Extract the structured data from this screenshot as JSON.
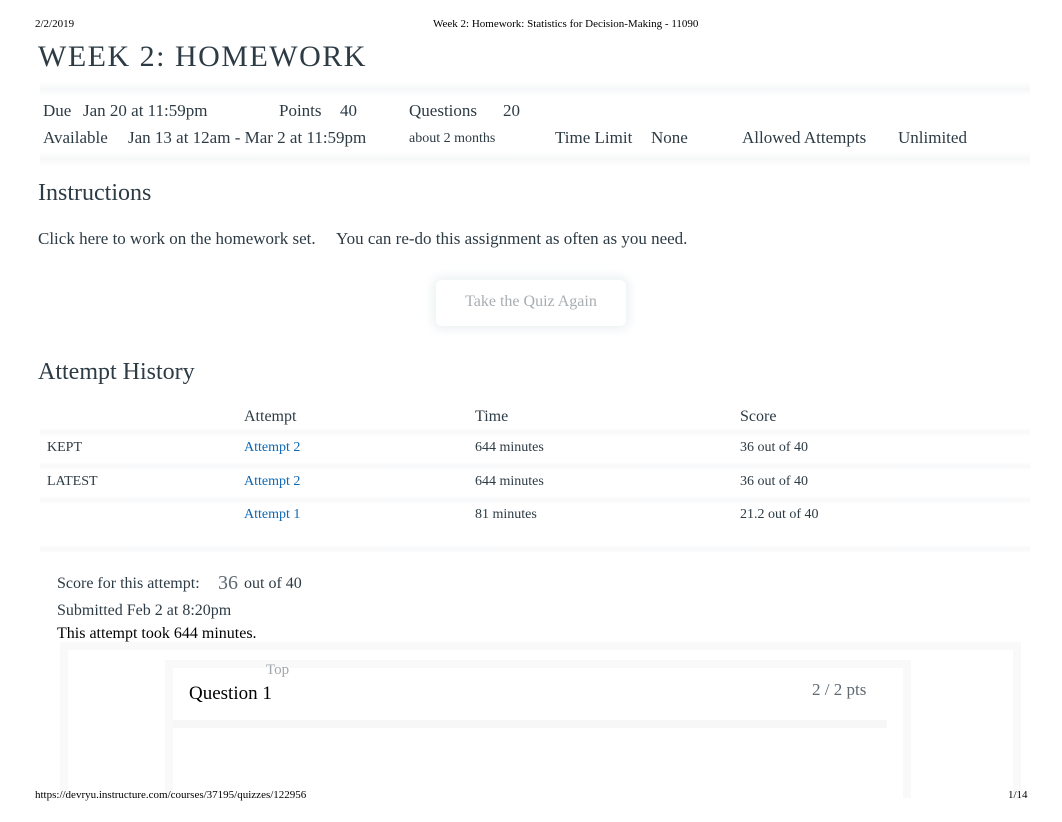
{
  "print_header": {
    "date": "2/2/2019",
    "doc_title": "Week 2: Homework: Statistics for Decision-Making - 11090"
  },
  "page_title": "WEEK 2: HOMEWORK",
  "details": {
    "due_label": "Due",
    "due_value": "Jan 20 at 11:59pm",
    "points_label": "Points",
    "points_value": "40",
    "questions_label": "Questions",
    "questions_value": "20",
    "available_label": "Available",
    "available_value": "Jan 13 at 12am - Mar 2 at 11:59pm",
    "available_duration": "about 2 months",
    "time_limit_label": "Time Limit",
    "time_limit_value": "None",
    "attempts_label": "Allowed Attempts",
    "attempts_value": "Unlimited"
  },
  "instructions": {
    "heading": "Instructions",
    "link_text": "Click here to work on the homework set.",
    "note": "You can re-do this assignment as often as you need."
  },
  "take_quiz_button": "Take the Quiz Again",
  "attempt_history": {
    "heading": "Attempt History",
    "columns": [
      "",
      "Attempt",
      "Time",
      "Score"
    ],
    "rows": [
      {
        "tag": "KEPT",
        "attempt": "Attempt 2",
        "time": "644 minutes",
        "score": "36 out of 40"
      },
      {
        "tag": "LATEST",
        "attempt": "Attempt 2",
        "time": "644 minutes",
        "score": "36 out of 40"
      },
      {
        "tag": "",
        "attempt": "Attempt 1",
        "time": "81 minutes",
        "score": "21.2 out of 40"
      }
    ]
  },
  "score_summary": {
    "label": "Score for this attempt:",
    "score": "36",
    "out_of": "out of 40",
    "submitted": "Submitted Feb 2 at 8:20pm",
    "duration": "This attempt took 644 minutes."
  },
  "question": {
    "top_link": "Top",
    "title": "Question 1",
    "points": "2 / 2 pts"
  },
  "print_footer": {
    "url": "https://devryu.instructure.com/courses/37195/quizzes/122956",
    "page": "1/14"
  },
  "colors": {
    "link": "#0e68b3",
    "text": "#2d3b45"
  }
}
